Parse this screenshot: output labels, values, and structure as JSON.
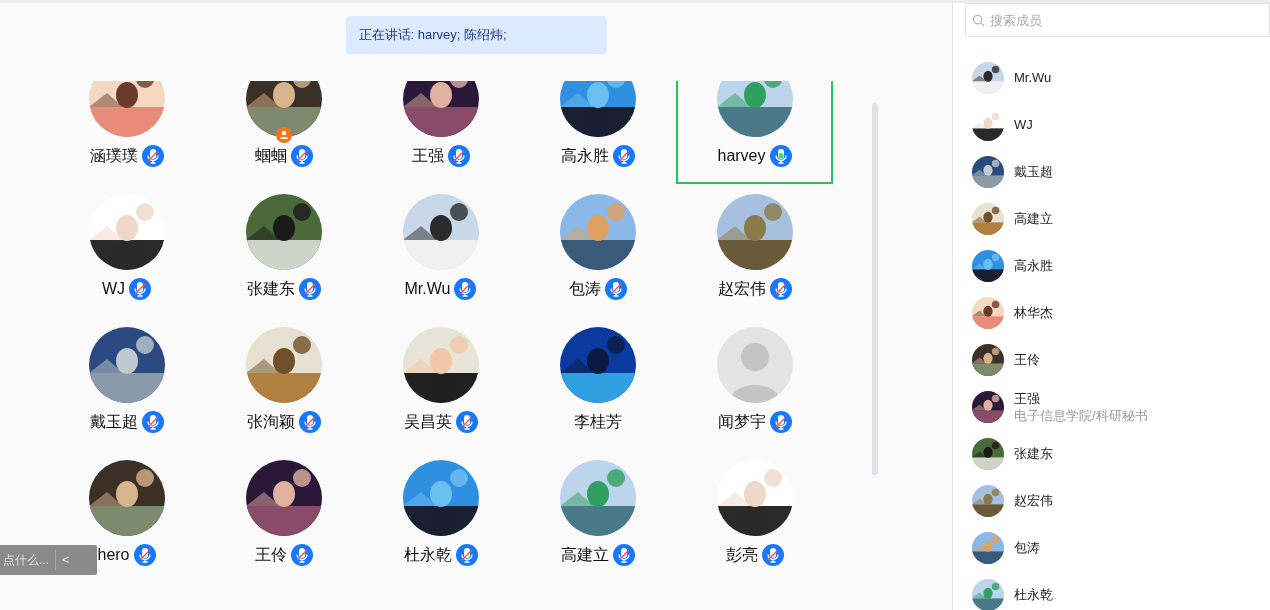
{
  "speaking_banner": "正在讲话: harvey; 陈绍炜;",
  "members": [
    {
      "name": "涵璞璞",
      "mic": {
        "kind": "muted"
      },
      "host": false,
      "selected": false
    },
    {
      "name": "蝈蝈",
      "mic": {
        "kind": "muted"
      },
      "host": true,
      "selected": false
    },
    {
      "name": "王强",
      "mic": {
        "kind": "muted"
      },
      "host": false,
      "selected": false
    },
    {
      "name": "高永胜",
      "mic": {
        "kind": "muted"
      },
      "host": false,
      "selected": false
    },
    {
      "name": "harvey",
      "mic": {
        "kind": "speaking"
      },
      "host": false,
      "selected": true
    },
    {
      "name": "WJ",
      "mic": {
        "kind": "muted"
      },
      "host": false,
      "selected": false
    },
    {
      "name": "张建东",
      "mic": {
        "kind": "muted"
      },
      "host": false,
      "selected": false
    },
    {
      "name": "Mr.Wu",
      "mic": {
        "kind": "muted"
      },
      "host": false,
      "selected": false
    },
    {
      "name": "包涛",
      "mic": {
        "kind": "muted"
      },
      "host": false,
      "selected": false
    },
    {
      "name": "赵宏伟",
      "mic": {
        "kind": "muted"
      },
      "host": false,
      "selected": false
    },
    {
      "name": "戴玉超",
      "mic": {
        "kind": "muted"
      },
      "host": false,
      "selected": false
    },
    {
      "name": "张洵颖",
      "mic": {
        "kind": "muted"
      },
      "host": false,
      "selected": false
    },
    {
      "name": "吴昌英",
      "mic": {
        "kind": "muted"
      },
      "host": false,
      "selected": false
    },
    {
      "name": "李桂芳",
      "host": false,
      "selected": false
    },
    {
      "name": "闻梦宇",
      "mic": {
        "kind": "muted"
      },
      "avatar": {
        "kind": "default"
      },
      "host": false,
      "selected": false
    },
    {
      "name": "hero",
      "mic": {
        "kind": "muted"
      },
      "host": false,
      "selected": false
    },
    {
      "name": "王伶",
      "mic": {
        "kind": "muted"
      },
      "host": false,
      "selected": false
    },
    {
      "name": "杜永乾",
      "mic": {
        "kind": "muted"
      },
      "host": false,
      "selected": false
    },
    {
      "name": "高建立",
      "mic": {
        "kind": "muted"
      },
      "host": false,
      "selected": false
    },
    {
      "name": "彭亮",
      "mic": {
        "kind": "muted"
      },
      "host": false,
      "selected": false
    }
  ],
  "chat_input": {
    "placeholder": "点什么...",
    "collapse": "<"
  },
  "sidebar": {
    "search": {
      "placeholder": "搜索成员"
    },
    "members": [
      {
        "name": "Mr.Wu"
      },
      {
        "name": "WJ"
      },
      {
        "name": "戴玉超"
      },
      {
        "name": "高建立"
      },
      {
        "name": "高永胜"
      },
      {
        "name": "林华杰"
      },
      {
        "name": "王伶"
      },
      {
        "name": "王强",
        "subtitle": "电子信息学院/科研秘书"
      },
      {
        "name": "张建东"
      },
      {
        "name": "赵宏伟"
      },
      {
        "name": "包涛"
      },
      {
        "name": "杜永乾"
      }
    ]
  }
}
